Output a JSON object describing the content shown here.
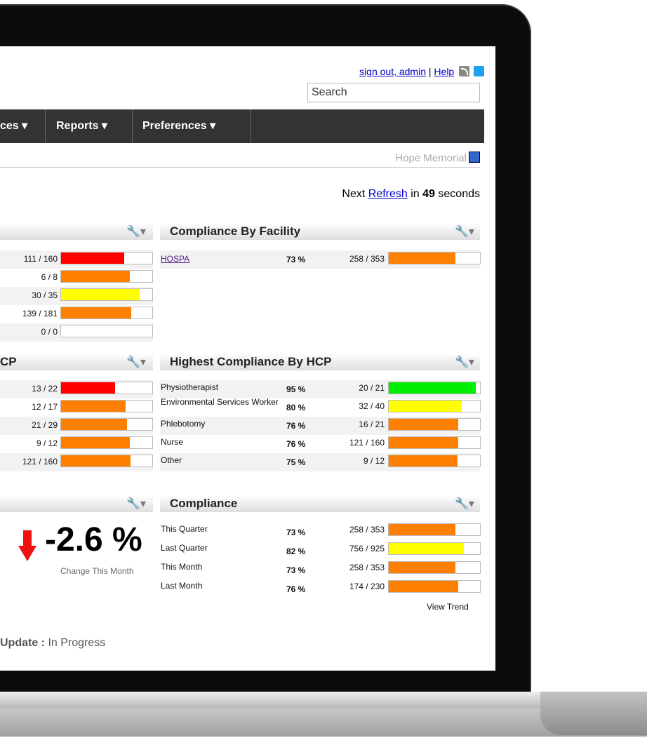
{
  "header": {
    "signout": "sign out, admin",
    "sep": "|",
    "help": "Help",
    "search_placeholder": "Search"
  },
  "nav": {
    "items": [
      "ces ▾",
      "Reports ▾",
      "Preferences ▾"
    ]
  },
  "facility_name": "Hope Memorial",
  "refresh": {
    "prefix": "Next",
    "link": "Refresh",
    "middle": "in",
    "seconds": "49",
    "suffix": "seconds"
  },
  "left_top_panel": {
    "rows": [
      {
        "frac": "111 / 160",
        "value": 0.69,
        "color": "#ff0000"
      },
      {
        "frac": "6 / 8",
        "value": 0.75,
        "color": "#ff8000"
      },
      {
        "frac": "30 / 35",
        "value": 0.86,
        "color": "#ffff00"
      },
      {
        "frac": "139 / 181",
        "value": 0.77,
        "color": "#ff8000"
      },
      {
        "frac": "0 / 0",
        "value": 0,
        "color": "#ffffff"
      }
    ]
  },
  "compliance_by_facility": {
    "title": "Compliance By Facility",
    "rows": [
      {
        "label": "HOSPA",
        "pct": "73 %",
        "frac": "258 / 353",
        "value": 0.73,
        "color": "#ff8000"
      }
    ]
  },
  "left_mid_panel": {
    "title": "CP",
    "rows": [
      {
        "frac": "13 / 22",
        "value": 0.59,
        "color": "#ff0000"
      },
      {
        "frac": "12 / 17",
        "value": 0.71,
        "color": "#ff8000"
      },
      {
        "frac": "21 / 29",
        "value": 0.72,
        "color": "#ff8000"
      },
      {
        "frac": "9 / 12",
        "value": 0.75,
        "color": "#ff8000"
      },
      {
        "frac": "121 / 160",
        "value": 0.76,
        "color": "#ff8000"
      }
    ]
  },
  "highest_compliance_by_hcp": {
    "title": "Highest Compliance By HCP",
    "rows": [
      {
        "label": "Physiotherapist",
        "pct": "95 %",
        "frac": "20 / 21",
        "value": 0.95,
        "color": "#00ee00"
      },
      {
        "label": "Environmental Services Worker",
        "pct": "80 %",
        "frac": "32 / 40",
        "value": 0.8,
        "color": "#ffff00"
      },
      {
        "label": "Phlebotomy",
        "pct": "76 %",
        "frac": "16 / 21",
        "value": 0.76,
        "color": "#ff8000"
      },
      {
        "label": "Nurse",
        "pct": "76 %",
        "frac": "121 / 160",
        "value": 0.76,
        "color": "#ff8000"
      },
      {
        "label": "Other",
        "pct": "75 %",
        "frac": "9 / 12",
        "value": 0.75,
        "color": "#ff8000"
      }
    ]
  },
  "change": {
    "value": "-2.6 %",
    "caption": "Change This Month"
  },
  "compliance": {
    "title": "Compliance",
    "rows": [
      {
        "label": "This Quarter",
        "pct": "73 %",
        "frac": "258 / 353",
        "value": 0.73,
        "color": "#ff8000"
      },
      {
        "label": "Last Quarter",
        "pct": "82 %",
        "frac": "756 / 925",
        "value": 0.82,
        "color": "#ffff00"
      },
      {
        "label": "This Month",
        "pct": "73 %",
        "frac": "258 / 353",
        "value": 0.73,
        "color": "#ff8000"
      },
      {
        "label": "Last Month",
        "pct": "76 %",
        "frac": "174 / 230",
        "value": 0.76,
        "color": "#ff8000"
      }
    ],
    "view_trend": "View Trend"
  },
  "update": {
    "label": "Update :",
    "status": "In Progress"
  }
}
